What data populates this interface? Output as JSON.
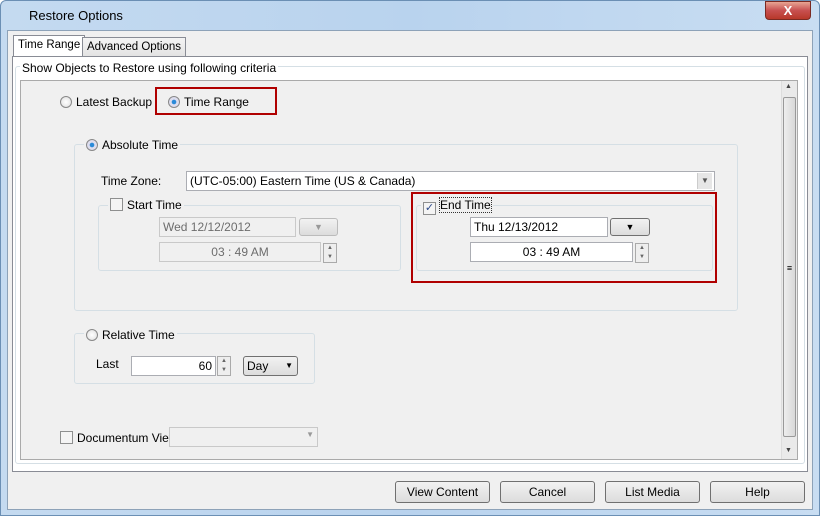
{
  "window": {
    "title": "Restore Options",
    "close_label": "X"
  },
  "tabs": [
    {
      "label": "Time Range",
      "active": true
    },
    {
      "label": "Advanced Options",
      "active": false
    }
  ],
  "criteria_label": "Show Objects to Restore using following criteria",
  "mode": {
    "latest_backup": "Latest Backup",
    "time_range": "Time Range",
    "selected": "Time Range"
  },
  "absolute": {
    "label": "Absolute Time",
    "selected": true,
    "timezone_label": "Time Zone:",
    "timezone_value": "(UTC-05:00) Eastern Time (US & Canada)",
    "start": {
      "label": "Start Time",
      "checked": false,
      "date": "Wed 12/12/2012",
      "hour": "03",
      "minute": "49 AM"
    },
    "end": {
      "label": "End Time",
      "checked": true,
      "date": "Thu 12/13/2012",
      "hour": "03",
      "minute": "49 AM"
    }
  },
  "relative": {
    "label": "Relative Time",
    "last_label": "Last",
    "value": "60",
    "unit": "Day"
  },
  "documentum": {
    "label": "Documentum View",
    "checked": false,
    "value": ""
  },
  "buttons": {
    "view_content": "View Content",
    "cancel": "Cancel",
    "list_media": "List Media",
    "help": "Help"
  },
  "colors": {
    "highlight": "#b00000",
    "radio_selected": "#2a8ad8"
  }
}
